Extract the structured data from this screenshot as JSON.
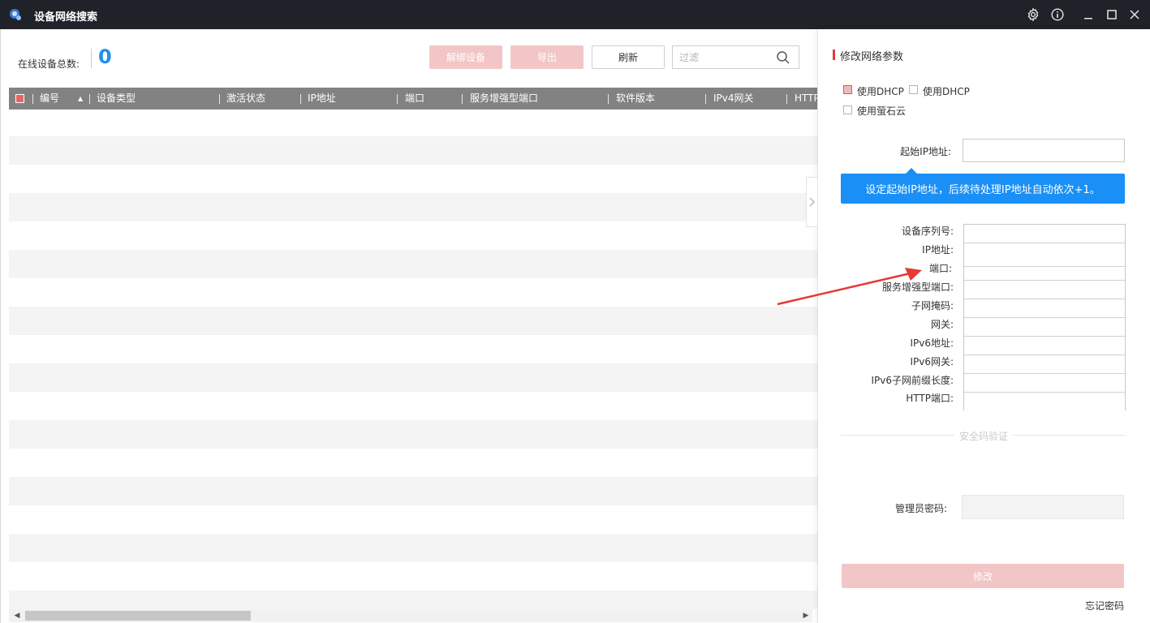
{
  "window": {
    "title": "设备网络搜索",
    "controls": {
      "settings_icon": "gear-icon",
      "info_icon": "info-icon",
      "minimize_icon": "minimize-icon",
      "maximize_icon": "maximize-icon",
      "close_icon": "close-icon"
    }
  },
  "toolbar": {
    "total_label": "在线设备总数:",
    "total_count": "0",
    "unbind_label": "解绑设备",
    "export_label": "导出",
    "refresh_label": "刷新",
    "filter_placeholder": "过滤"
  },
  "table": {
    "columns": [
      "编号",
      "设备类型",
      "激活状态",
      "IP地址",
      "端口",
      "服务增强型端口",
      "软件版本",
      "IPv4网关",
      "HTTP"
    ],
    "rows": []
  },
  "panel": {
    "title": "修改网络参数",
    "dhcp_label_1": "使用DHCP",
    "dhcp_label_2": "使用DHCP",
    "ezviz_label": "使用萤石云",
    "start_ip_label": "起始IP地址:",
    "tooltip": "设定起始IP地址，后续待处理IP地址自动依次+1。",
    "fields": [
      "设备序列号:",
      "IP地址:",
      "端口:",
      "服务增强型端口:",
      "子网掩码:",
      "网关:",
      "IPv6地址:",
      "IPv6网关:",
      "IPv6子网前缀长度:",
      "HTTP端口:"
    ],
    "security_label": "安全码验证",
    "admin_pwd_label": "管理员密码:",
    "modify_label": "修改",
    "forgot_label": "忘记密码"
  },
  "colors": {
    "accent_red": "#e03c3c",
    "pink_btn": "#f2c6c6",
    "blue": "#1a8ff5",
    "titlebar": "#1f2229",
    "header_gray": "#828282"
  }
}
